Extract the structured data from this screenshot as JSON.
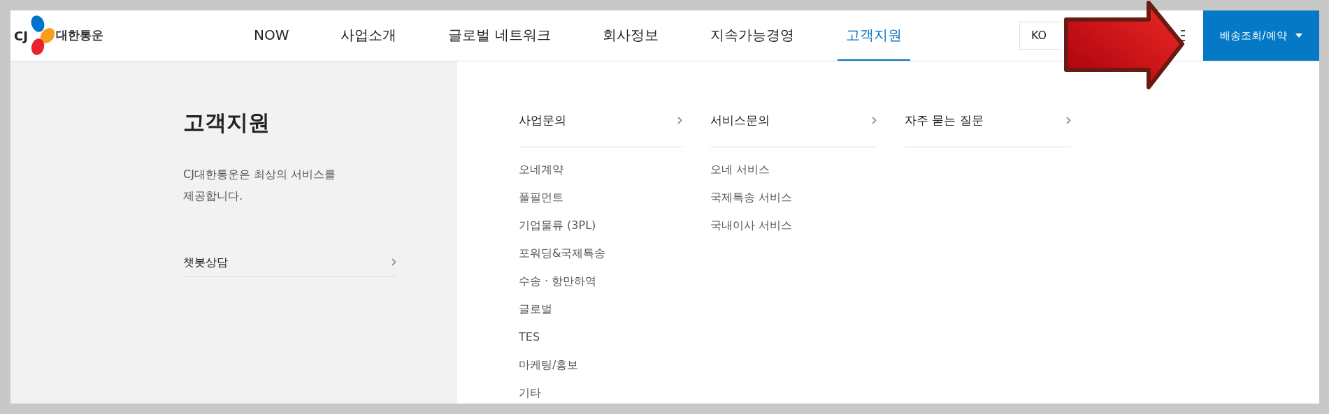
{
  "logo": {
    "mark": "CJ",
    "name": "대한통운"
  },
  "nav": [
    {
      "label": "NOW",
      "selected": false
    },
    {
      "label": "사업소개",
      "selected": false
    },
    {
      "label": "글로벌 네트워크",
      "selected": false
    },
    {
      "label": "회사정보",
      "selected": false
    },
    {
      "label": "지속가능경영",
      "selected": false
    },
    {
      "label": "고객지원",
      "selected": true
    }
  ],
  "language": {
    "value": "KO"
  },
  "track_button": "배송조회/예약",
  "panel": {
    "title": "고객지원",
    "description": "CJ대한통운은 최상의 서비스를 제공합니다.",
    "link": "챗봇상담"
  },
  "columns": [
    {
      "title": "사업문의",
      "items": [
        "오네계약",
        "풀필먼트",
        "기업물류 (3PL)",
        "포워딩&국제특송",
        "수송 · 항만하역",
        "글로벌",
        "TES",
        "마케팅/홍보",
        "기타"
      ]
    },
    {
      "title": "서비스문의",
      "items": [
        "오네 서비스",
        "국제특송 서비스",
        "국내이사 서비스"
      ]
    },
    {
      "title": "자주 묻는 질문"
    }
  ]
}
